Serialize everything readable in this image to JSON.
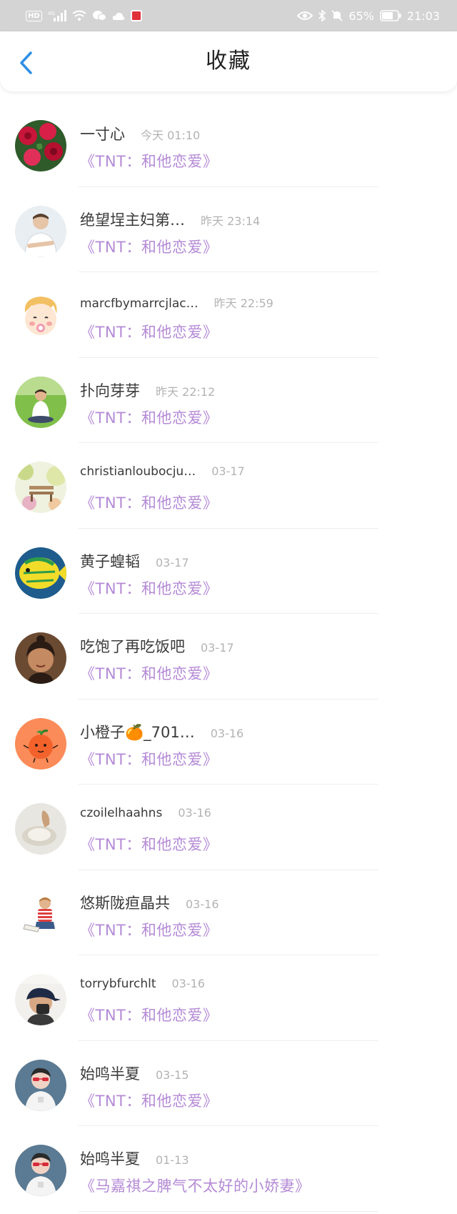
{
  "status_bar": {
    "battery": "65%",
    "time": "21:03",
    "network": "4G"
  },
  "header": {
    "title": "收藏"
  },
  "items": [
    {
      "name": "一寸心",
      "time": "今天 01:10",
      "work": "《TNT：和他恋爱》",
      "avatar": "roses"
    },
    {
      "name": "绝望埕主妇第…",
      "time": "昨天 23:14",
      "work": "《TNT：和他恋爱》",
      "avatar": "man-white-shirt"
    },
    {
      "name": "marcfbymarrcjlac…",
      "time": "昨天 22:59",
      "work": "《TNT：和他恋爱》",
      "avatar": "cartoon-baby"
    },
    {
      "name": "扑向芽芽",
      "time": "昨天 22:12",
      "work": "《TNT：和他恋爱》",
      "avatar": "boy-on-grass"
    },
    {
      "name": "christianloubocju…",
      "time": "03-17",
      "work": "《TNT：和他恋爱》",
      "avatar": "garden-bench"
    },
    {
      "name": "黄子蝗韬",
      "time": "03-17",
      "work": "《TNT：和他恋爱》",
      "avatar": "yellow-fish"
    },
    {
      "name": "吃饱了再吃饭吧",
      "time": "03-17",
      "work": "《TNT：和他恋爱》",
      "avatar": "person-portrait"
    },
    {
      "name": "小橙子🍊_701…",
      "time": "03-16",
      "work": "《TNT：和他恋爱》",
      "avatar": "orange-cartoon"
    },
    {
      "name": "czoilelhaahns",
      "time": "03-16",
      "work": "《TNT：和他恋爱》",
      "avatar": "hand-object"
    },
    {
      "name": "悠斯陇疸晶共",
      "time": "03-16",
      "work": "《TNT：和他恋爱》",
      "avatar": "child-reading"
    },
    {
      "name": "torrybfurchlt",
      "time": "03-16",
      "work": "《TNT：和他恋爱》",
      "avatar": "capped-person"
    },
    {
      "name": "始鸣半夏",
      "time": "03-15",
      "work": "《TNT：和他恋爱》",
      "avatar": "red-glasses-person"
    },
    {
      "name": "始鸣半夏",
      "time": "01-13",
      "work": "《马嘉祺之脾气不太好的小娇妻》",
      "avatar": "red-glasses-person"
    }
  ]
}
